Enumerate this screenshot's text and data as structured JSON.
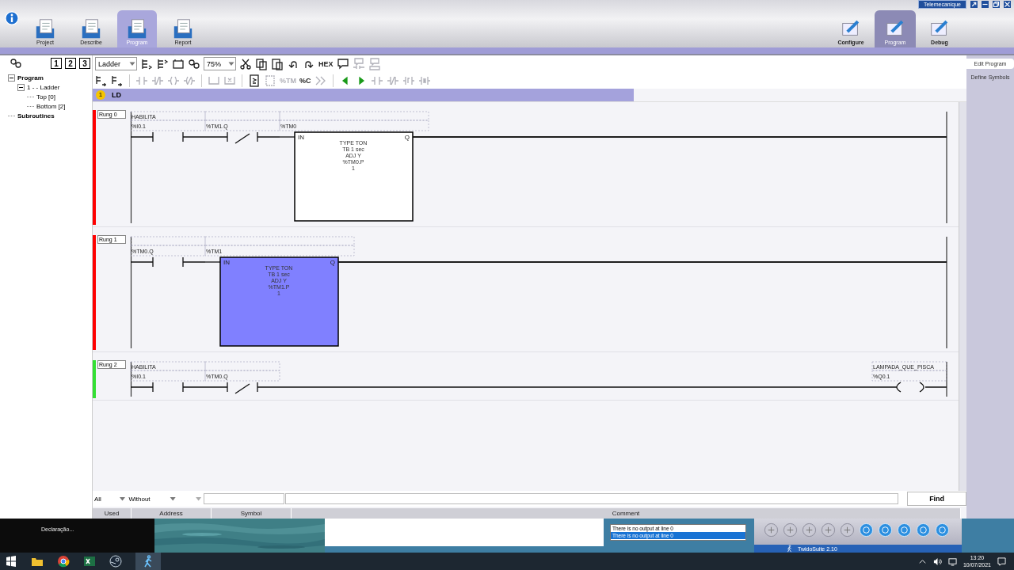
{
  "window": {
    "brand": "Telemecanique"
  },
  "app_tabs": [
    {
      "label": "Project",
      "selected": false
    },
    {
      "label": "Describe",
      "selected": false
    },
    {
      "label": "Program",
      "selected": true
    },
    {
      "label": "Report",
      "selected": false
    }
  ],
  "mode_tabs": [
    {
      "label": "Configure",
      "selected": false
    },
    {
      "label": "Program",
      "selected": true
    },
    {
      "label": "Debug",
      "selected": false
    }
  ],
  "side_tabs": [
    {
      "label": "Edit Program",
      "selected": true
    },
    {
      "label": "Define Symbols",
      "selected": false
    }
  ],
  "level_buttons": [
    "1",
    "2",
    "3"
  ],
  "tree": [
    {
      "label": "Program",
      "expanded": true,
      "children": [
        {
          "label": "1 -  - Ladder",
          "expanded": true,
          "children": [
            {
              "label": "Top [0]"
            },
            {
              "label": "Bottom [2]"
            }
          ]
        }
      ]
    },
    {
      "label": "Subroutines"
    }
  ],
  "toolbar": {
    "row_1": [
      {
        "kind": "select",
        "value": "Ladder"
      },
      {
        "kind": "icon",
        "disabled": false
      },
      {
        "kind": "icon",
        "disabled": false
      },
      {
        "kind": "icon",
        "disabled": false
      },
      {
        "kind": "icon",
        "disabled": false
      },
      {
        "kind": "select",
        "value": "75%"
      },
      {
        "kind": "icon",
        "disabled": false
      },
      {
        "kind": "icon",
        "disabled": false
      },
      {
        "kind": "icon",
        "disabled": false
      },
      {
        "kind": "icon",
        "disabled": false
      },
      {
        "kind": "icon",
        "disabled": false
      },
      {
        "kind": "text",
        "label": "HEX",
        "disabled": false
      },
      {
        "kind": "icon",
        "disabled": false
      },
      {
        "kind": "icon",
        "disabled": true
      },
      {
        "kind": "icon",
        "disabled": true
      }
    ],
    "row_2": [
      {
        "kind": "icon",
        "disabled": false
      },
      {
        "kind": "icon",
        "disabled": false
      },
      {
        "kind": "icon",
        "disabled": true
      },
      {
        "kind": "icon",
        "disabled": true
      },
      {
        "kind": "icon",
        "disabled": true
      },
      {
        "kind": "icon",
        "disabled": true
      },
      {
        "kind": "icon",
        "disabled": true
      },
      {
        "kind": "icon",
        "disabled": true
      },
      {
        "kind": "icon",
        "disabled": false
      },
      {
        "kind": "icon",
        "disabled": true
      },
      {
        "kind": "text",
        "label": "%TM",
        "disabled": true
      },
      {
        "kind": "text",
        "label": "%C",
        "disabled": false
      },
      {
        "kind": "icon",
        "disabled": true
      },
      {
        "kind": "icon",
        "disabled": false
      },
      {
        "kind": "icon",
        "disabled": false
      },
      {
        "kind": "icon",
        "disabled": true
      },
      {
        "kind": "icon",
        "disabled": true
      },
      {
        "kind": "icon",
        "disabled": true
      },
      {
        "kind": "icon",
        "disabled": true
      }
    ]
  },
  "section": {
    "number": "1",
    "label": "LD"
  },
  "rungs": [
    {
      "label": "Rung 0",
      "color": "#ff0000",
      "elements": [
        {
          "kind": "contact_no",
          "symbol": "HABILITA",
          "address": "%I0.1"
        },
        {
          "kind": "contact_nc",
          "address": "%TM1.Q"
        },
        {
          "kind": "timer",
          "address": "%TM0",
          "selected": false,
          "input": "IN",
          "output": "Q",
          "params": [
            "TYPE  TON",
            "TB     1 sec",
            "ADJ     Y",
            "%TM0.P",
            "1"
          ]
        }
      ]
    },
    {
      "label": "Rung 1",
      "color": "#ff0000",
      "elements": [
        {
          "kind": "contact_no",
          "address": "%TM0.Q"
        },
        {
          "kind": "timer",
          "address": "%TM1",
          "selected": true,
          "input": "IN",
          "output": "Q",
          "params": [
            "TYPE  TON",
            "TB     1 sec",
            "ADJ     Y",
            "%TM1.P",
            "1"
          ]
        }
      ]
    },
    {
      "label": "Rung 2",
      "color": "#33e033",
      "elements": [
        {
          "kind": "contact_no",
          "symbol": "HABILITA",
          "address": "%I0.1"
        },
        {
          "kind": "contact_nc",
          "address": "%TM0.Q"
        },
        {
          "kind": "coil",
          "symbol": "LAMPADA_QUE_PISCA",
          "address": "%Q0.1"
        }
      ]
    }
  ],
  "filter": {
    "scope": "All",
    "usage": "Without",
    "find": "Find"
  },
  "symbol_table": {
    "columns": [
      "Used",
      "Address",
      "Symbol",
      "Comment"
    ]
  },
  "background_window": "Declaração...",
  "output": [
    {
      "text": "There is no output at line 0",
      "selected": false
    },
    {
      "text": "There is no output at line 0",
      "selected": true
    }
  ],
  "status": "TwidoSuite 2.10",
  "clock": {
    "time": "13:20",
    "date": "10/07/2021"
  }
}
